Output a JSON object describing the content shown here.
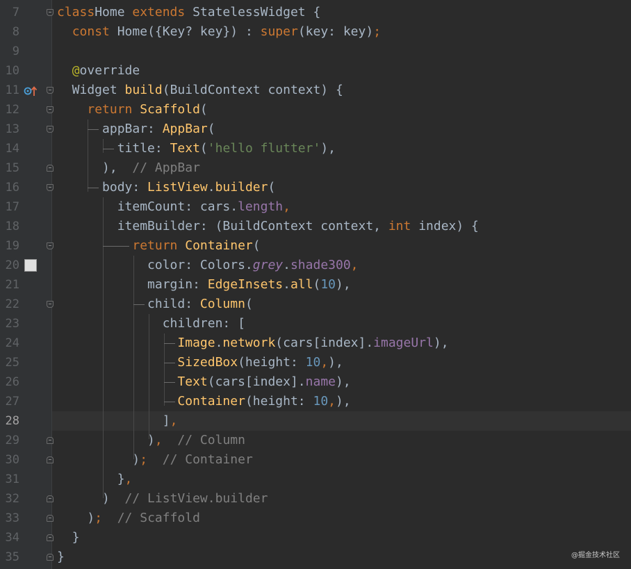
{
  "editor": {
    "current_line": 28,
    "lines": [
      {
        "n": "7",
        "tokens": [
          [
            "kw",
            "class"
          ],
          [
            "",
            "Home "
          ],
          [
            "kw",
            "extends "
          ],
          [
            "",
            "StatelessWidget {"
          ]
        ]
      },
      {
        "n": "8",
        "tokens": [
          [
            "",
            "  "
          ],
          [
            "kw",
            "const "
          ],
          [
            "",
            "Home({Key? key}) : "
          ],
          [
            "kw",
            "super"
          ],
          [
            "",
            "(key: key)"
          ],
          [
            "kw",
            ";"
          ]
        ]
      },
      {
        "n": "9",
        "tokens": []
      },
      {
        "n": "10",
        "tokens": [
          [
            "",
            "  "
          ],
          [
            "ann",
            "@"
          ],
          [
            "",
            "override"
          ]
        ]
      },
      {
        "n": "11",
        "tokens": [
          [
            "",
            "  Widget "
          ],
          [
            "fn",
            "build"
          ],
          [
            "",
            "(BuildContext context) {"
          ]
        ]
      },
      {
        "n": "12",
        "tokens": [
          [
            "",
            "    "
          ],
          [
            "kw",
            "return "
          ],
          [
            "fn",
            "Scaffold"
          ],
          [
            "",
            "("
          ]
        ]
      },
      {
        "n": "13",
        "tokens": [
          [
            "",
            "      appBar: "
          ],
          [
            "fn",
            "AppBar"
          ],
          [
            "",
            "("
          ]
        ]
      },
      {
        "n": "14",
        "tokens": [
          [
            "",
            "        title: "
          ],
          [
            "fn",
            "Text"
          ],
          [
            "",
            "("
          ],
          [
            "str",
            "'hello flutter'"
          ],
          [
            "",
            "),"
          ]
        ]
      },
      {
        "n": "15",
        "tokens": [
          [
            "",
            "      ),  "
          ],
          [
            "cm",
            "// AppBar"
          ]
        ]
      },
      {
        "n": "16",
        "tokens": [
          [
            "",
            "      body: "
          ],
          [
            "fn",
            "ListView"
          ],
          [
            "",
            "."
          ],
          [
            "fn",
            "builder"
          ],
          [
            "",
            "("
          ]
        ]
      },
      {
        "n": "17",
        "tokens": [
          [
            "",
            "        itemCount: cars."
          ],
          [
            "prop",
            "length"
          ],
          [
            "kw",
            ","
          ]
        ]
      },
      {
        "n": "18",
        "tokens": [
          [
            "",
            "        itemBuilder: (BuildContext context, "
          ],
          [
            "kw",
            "int "
          ],
          [
            "",
            "index) {"
          ]
        ]
      },
      {
        "n": "19",
        "tokens": [
          [
            "",
            "          "
          ],
          [
            "kw",
            "return "
          ],
          [
            "fn",
            "Container"
          ],
          [
            "",
            "("
          ]
        ]
      },
      {
        "n": "20",
        "tokens": [
          [
            "",
            "            color: Colors."
          ],
          [
            "prop-i",
            "grey"
          ],
          [
            "",
            "."
          ],
          [
            "prop",
            "shade300"
          ],
          [
            "kw",
            ","
          ]
        ]
      },
      {
        "n": "21",
        "tokens": [
          [
            "",
            "            margin: "
          ],
          [
            "fn",
            "EdgeInsets"
          ],
          [
            "",
            "."
          ],
          [
            "fn",
            "all"
          ],
          [
            "",
            "("
          ],
          [
            "num",
            "10"
          ],
          [
            "",
            "),"
          ]
        ]
      },
      {
        "n": "22",
        "tokens": [
          [
            "",
            "            child: "
          ],
          [
            "fn",
            "Column"
          ],
          [
            "",
            "("
          ]
        ]
      },
      {
        "n": "23",
        "tokens": [
          [
            "",
            "              children: ["
          ]
        ]
      },
      {
        "n": "24",
        "tokens": [
          [
            "",
            "                "
          ],
          [
            "fn",
            "Image"
          ],
          [
            "",
            "."
          ],
          [
            "fn",
            "network"
          ],
          [
            "",
            "(cars[index]."
          ],
          [
            "prop",
            "imageUrl"
          ],
          [
            "",
            "),"
          ]
        ]
      },
      {
        "n": "25",
        "tokens": [
          [
            "",
            "                "
          ],
          [
            "fn",
            "SizedBox"
          ],
          [
            "",
            "(height: "
          ],
          [
            "num",
            "10"
          ],
          [
            "kw",
            ","
          ],
          [
            "",
            "),"
          ]
        ]
      },
      {
        "n": "26",
        "tokens": [
          [
            "",
            "                "
          ],
          [
            "fn",
            "Text"
          ],
          [
            "",
            "(cars[index]."
          ],
          [
            "prop",
            "name"
          ],
          [
            "",
            "),"
          ]
        ]
      },
      {
        "n": "27",
        "tokens": [
          [
            "",
            "                "
          ],
          [
            "fn",
            "Container"
          ],
          [
            "",
            "(height: "
          ],
          [
            "num",
            "10"
          ],
          [
            "kw",
            ","
          ],
          [
            "",
            "),"
          ]
        ]
      },
      {
        "n": "28",
        "tokens": [
          [
            "",
            "              ]"
          ],
          [
            "kw",
            ","
          ]
        ]
      },
      {
        "n": "29",
        "tokens": [
          [
            "",
            "            )"
          ],
          [
            "kw",
            ","
          ],
          [
            "",
            "  "
          ],
          [
            "cm",
            "// Column"
          ]
        ]
      },
      {
        "n": "30",
        "tokens": [
          [
            "",
            "          )"
          ],
          [
            "kw",
            ";"
          ],
          [
            "",
            "  "
          ],
          [
            "cm",
            "// Container"
          ]
        ]
      },
      {
        "n": "31",
        "tokens": [
          [
            "",
            "        }"
          ],
          [
            "kw",
            ","
          ]
        ]
      },
      {
        "n": "32",
        "tokens": [
          [
            "",
            "      )  "
          ],
          [
            "cm",
            "// ListView.builder"
          ]
        ]
      },
      {
        "n": "33",
        "tokens": [
          [
            "",
            "    )"
          ],
          [
            "kw",
            ";"
          ],
          [
            "",
            "  "
          ],
          [
            "cm",
            "// Scaffold"
          ]
        ]
      },
      {
        "n": "34",
        "tokens": [
          [
            "",
            "  }"
          ]
        ]
      },
      {
        "n": "35",
        "tokens": [
          [
            "",
            "}"
          ]
        ]
      }
    ]
  },
  "watermark": "@掘金技术社区",
  "icons": {
    "override": "override-up-arrow-icon",
    "swatch_color": "#e0e0e0"
  }
}
